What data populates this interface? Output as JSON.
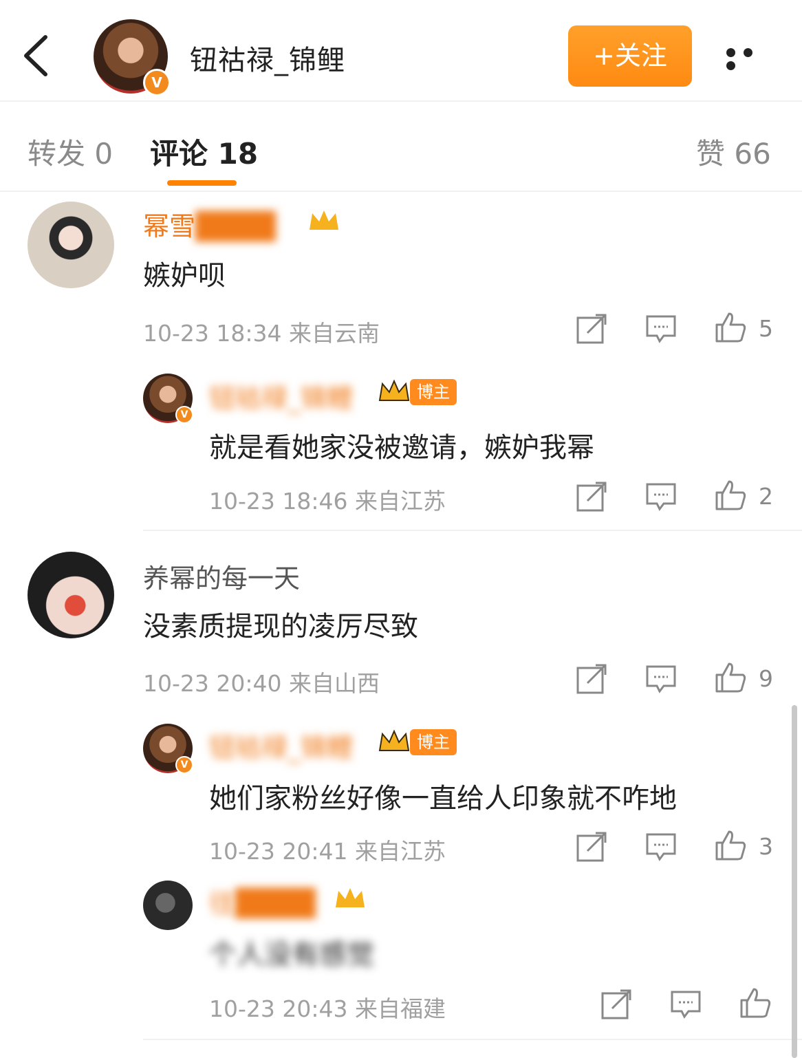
{
  "header": {
    "back_icon": "chevron-left-icon",
    "username": "钮祜禄_锦鲤",
    "follow_label": "+关注",
    "more_icon": "more-dots-icon",
    "verified_mark": "V"
  },
  "tabs": {
    "repost": "转发 0",
    "comments": "评论 18",
    "likes": "赞 66"
  },
  "comments": [
    {
      "user": "幂雪",
      "text": "嫉妒呗",
      "time": "10-23 18:34",
      "location": "来自云南",
      "likes": "5"
    },
    {
      "user": "钮祜禄_锦鲤",
      "badge": "博主",
      "text": "就是看她家没被邀请，嫉妒我幂",
      "time": "10-23 18:46",
      "location": "来自江苏",
      "likes": "2"
    },
    {
      "user": "养幂的每一天",
      "text": "没素质提现的凌厉尽致",
      "time": "10-23 20:40",
      "location": "来自山西",
      "likes": "9"
    },
    {
      "user": "钮祜禄_锦鲤",
      "badge": "博主",
      "text": "她们家粉丝好像一直给人印象就不咋地",
      "time": "10-23 20:41",
      "location": "来自江苏",
      "likes": "3"
    },
    {
      "user": "往",
      "text": "个人没有感觉",
      "time": "10-23 20:43",
      "location": "来自福建",
      "likes": ""
    }
  ],
  "icons": {
    "share": "share-icon",
    "reply": "comment-icon",
    "like": "thumbs-up-icon",
    "crown": "crown-icon"
  },
  "colors": {
    "accent": "#ff8200",
    "username_orange": "#f07a1a",
    "meta_gray": "#a0a0a0"
  }
}
